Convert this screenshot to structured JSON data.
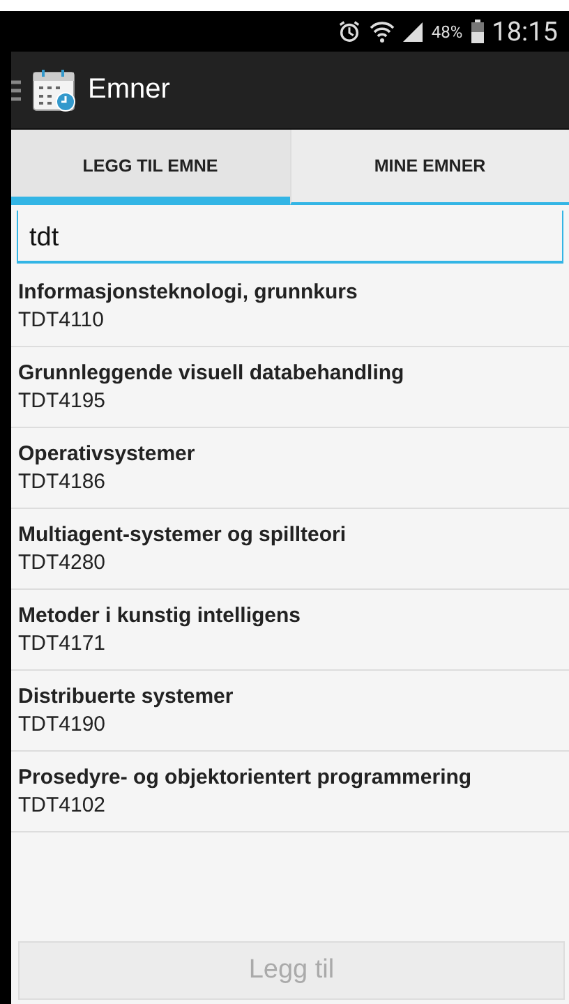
{
  "status_bar": {
    "battery": "48%",
    "time": "18:15"
  },
  "action_bar": {
    "title": "Emner"
  },
  "tabs": [
    {
      "label": "LEGG TIL EMNE",
      "selected": true
    },
    {
      "label": "MINE EMNER",
      "selected": false
    }
  ],
  "search": {
    "value": "tdt"
  },
  "courses": [
    {
      "name": "Informasjonsteknologi, grunnkurs",
      "code": "TDT4110"
    },
    {
      "name": "Grunnleggende visuell databehandling",
      "code": "TDT4195"
    },
    {
      "name": "Operativsystemer",
      "code": "TDT4186"
    },
    {
      "name": "Multiagent-systemer og spillteori",
      "code": "TDT4280"
    },
    {
      "name": "Metoder i kunstig intelligens",
      "code": "TDT4171"
    },
    {
      "name": "Distribuerte systemer",
      "code": "TDT4190"
    },
    {
      "name": "Prosedyre- og objektorientert programmering",
      "code": "TDT4102"
    }
  ],
  "add_button": {
    "label": "Legg til",
    "disabled": true
  }
}
